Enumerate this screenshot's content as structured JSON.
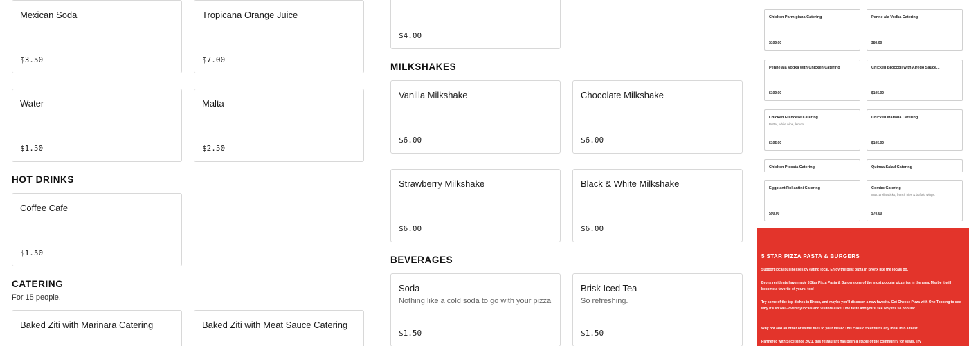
{
  "left_column": {
    "cards_top": [
      {
        "name": "Mexican Soda",
        "price": "$3.50"
      },
      {
        "name": "Tropicana Orange Juice",
        "price": "$7.00"
      },
      {
        "name": "Water",
        "price": "$1.50"
      },
      {
        "name": "Malta",
        "price": "$2.50"
      }
    ],
    "hot_drinks": {
      "heading": "HOT DRINKS",
      "items": [
        {
          "name": "Coffee Cafe",
          "price": "$1.50"
        }
      ]
    },
    "catering": {
      "heading": "CATERING",
      "subheading": "For 15 people.",
      "items": [
        {
          "name": "Baked Ziti with Marinara Catering"
        },
        {
          "name": "Baked Ziti with Meat Sauce Catering"
        }
      ]
    }
  },
  "middle_column": {
    "top_card": {
      "price": "$4.00"
    },
    "milkshakes": {
      "heading": "MILKSHAKES",
      "items": [
        {
          "name": "Vanilla Milkshake",
          "price": "$6.00"
        },
        {
          "name": "Chocolate Milkshake",
          "price": "$6.00"
        },
        {
          "name": "Strawberry Milkshake",
          "price": "$6.00"
        },
        {
          "name": "Black & White Milkshake",
          "price": "$6.00"
        }
      ]
    },
    "beverages": {
      "heading": "BEVERAGES",
      "items": [
        {
          "name": "Soda",
          "description": "Nothing like a cold soda to go with your pizza",
          "price": "$1.50"
        },
        {
          "name": "Brisk Iced Tea",
          "description": "So refreshing.",
          "price": "$1.50"
        }
      ]
    }
  },
  "right_column": {
    "items": [
      {
        "name": "Chicken Parmigiana Catering",
        "description": "",
        "price": "$100.00"
      },
      {
        "name": "Penne ala Vodka Catering",
        "description": "",
        "price": "$80.00"
      },
      {
        "name": "Penne ala Vodka with Chicken Catering",
        "description": "",
        "price": "$100.00"
      },
      {
        "name": "Chicken Broccoli with Alredo Sauce...",
        "description": "",
        "price": "$105.00"
      },
      {
        "name": "Chicken Francese Catering",
        "description": "Butter, white wine, lemon.",
        "price": "$105.00"
      },
      {
        "name": "Chicken Marsala Catering",
        "description": "",
        "price": "$105.00"
      },
      {
        "name": "Chicken Piccata Catering",
        "description": "",
        "price": ""
      },
      {
        "name": "Quinoa Salad Catering",
        "description": "",
        "price": ""
      },
      {
        "name": "Eggplant Rollantini Catering",
        "description": "",
        "price": "$90.00"
      },
      {
        "name": "Combo Catering",
        "description": "Mozzarella sticks, french fries & buffalo wings.",
        "price": "$70.00"
      }
    ],
    "footer": {
      "title": "5 STAR PIZZA PASTA & BURGERS",
      "paragraphs": [
        "Support local businesses by eating local. Enjoy the best pizza in Bronx like the locals do.",
        "Bronx residents have made 5 Star Pizza Pasta & Burgers one of the most popular pizzerias in the area. Maybe it will become a favorite of yours, too!",
        "Try some of the top dishes in Bronx, and maybe you'll discover a new favorite. Get Cheese Pizza with One Topping to see why it's so well-loved by locals and visitors alike. One taste and you'll see why it's so popular.",
        "Why not add an order of waffle fries to your meal? This classic treat turns any meal into a feast.",
        "Partnered with Slice since 2021, this restaurant has been a staple of the community for years. Try"
      ],
      "accent_color": "#e3342b"
    }
  }
}
